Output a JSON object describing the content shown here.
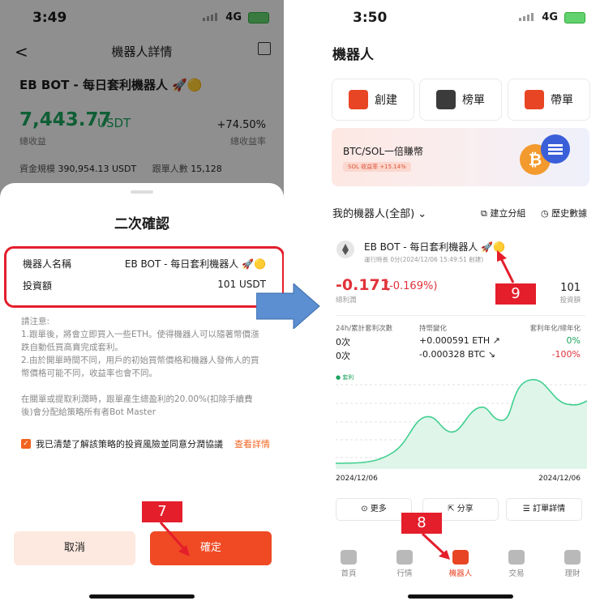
{
  "left": {
    "status": {
      "time": "3:49",
      "network": "4G"
    },
    "header": {
      "title": "機器人詳情"
    },
    "bot_title": "EB BOT - 每日套利機器人 🚀🟡",
    "profit": {
      "value": "7,443.77",
      "unit": "USDT",
      "label": "總收益"
    },
    "rate": {
      "value": "+74.50%",
      "label": "總收益率"
    },
    "stats": {
      "fund_label": "資金規模",
      "fund_value": "390,954.13 USDT",
      "followers_label": "跟單人數",
      "followers_value": "15,128"
    },
    "sheet": {
      "title": "二次確認",
      "rows": [
        {
          "label": "機器人名稱",
          "value": "EB BOT - 每日套利機器人 🚀🟡"
        },
        {
          "label": "投資額",
          "value": "101 USDT"
        }
      ],
      "note": [
        "請注意:",
        "1.跟單後，將會立即買入一些ETH。使得機器人可以隨著幣價漲跌自動低買高賣完成套利。",
        "2.由於開單時間不同，用戶的初始買幣價格和機器人發佈人的買幣價格可能不同，收益率也會不同。",
        "",
        "在關單或提取利潤時，跟單產生總盈利的20.00%(扣除手續費後)會分配給策略所有者Bot Master"
      ],
      "agree_text": "我已清楚了解該策略的投資風險並同意分潤協議",
      "agree_link": "查看詳情",
      "cancel_label": "取消",
      "confirm_label": "確定"
    },
    "marker": "7"
  },
  "right": {
    "status": {
      "time": "3:50",
      "network": "4G"
    },
    "title": "機器人",
    "buttons": [
      "創建",
      "榜單",
      "帶單"
    ],
    "banner": {
      "title": "BTC/SOL一倍賺幣",
      "tag": "SOL 收益率 +15.14%"
    },
    "my_bots": "我的機器人(全部)",
    "group_link": "建立分組",
    "history_link": "歷史數據",
    "card": {
      "name": "EB BOT - 每日套利機器人 🚀🟡",
      "sub": "運行時長 0分(2024/12/06 15:49:51 創建)",
      "pnl": "-0.171",
      "pnl_pct": "(-0.169%)",
      "pnl_label": "總利潤",
      "investment": "101",
      "investment_label": "投資額",
      "col1_header": "24h/累計套利次數",
      "col2_header": "持幣變化",
      "col3_header": "套利年化/總年化",
      "col1": [
        "0次",
        "0次"
      ],
      "col2": [
        "+0.000591 ETH ↗",
        "-0.000328 BTC ↘"
      ],
      "col3": [
        "0%",
        "-100%"
      ],
      "legend": "套利",
      "date_start": "2024/12/06",
      "date_end": "2024/12/06",
      "actions": [
        "更多",
        "分享",
        "訂單詳情"
      ]
    },
    "tabs": [
      "首頁",
      "行情",
      "機器人",
      "交易",
      "理財"
    ],
    "markers": [
      "8",
      "9"
    ]
  },
  "colors": {
    "accent": "#f04a24",
    "marker": "#e41e2b",
    "positive": "#1aa35c",
    "negative": "#e0323a",
    "chart_line": "#3fcf8e"
  }
}
